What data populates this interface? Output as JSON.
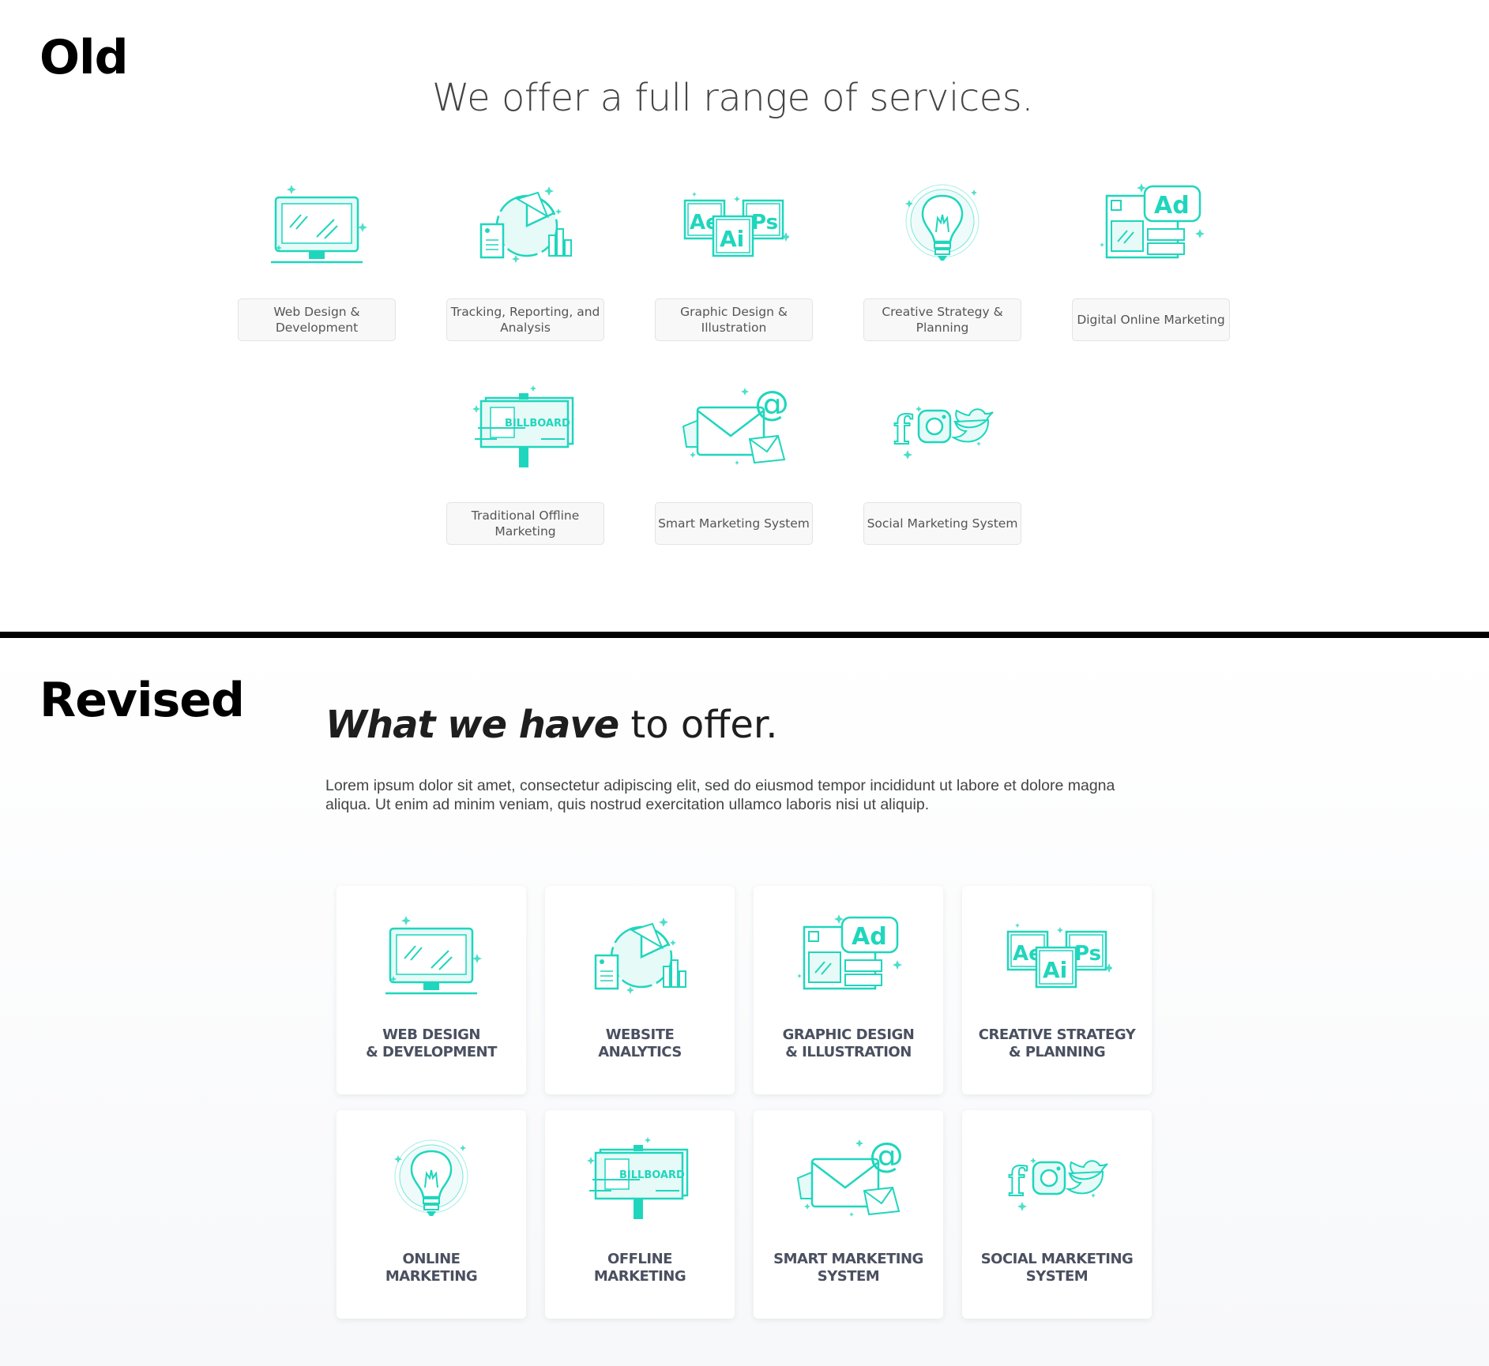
{
  "old": {
    "label": "Old",
    "heading": "We offer a full range of services.",
    "services": [
      {
        "icon": "monitor-code-icon",
        "label": "Web Design & Development"
      },
      {
        "icon": "pie-chart-report-icon",
        "label": "Tracking, Reporting, and Analysis"
      },
      {
        "icon": "adobe-apps-icon",
        "label": "Graphic Design & Illustration"
      },
      {
        "icon": "lightbulb-icon",
        "label": "Creative Strategy & Planning"
      },
      {
        "icon": "ad-browser-icon",
        "label": "Digital Online Marketing"
      },
      {
        "icon": "billboard-icon",
        "label": "Traditional Offline Marketing"
      },
      {
        "icon": "envelope-at-icon",
        "label": "Smart Marketing System"
      },
      {
        "icon": "social-icons-icon",
        "label": "Social Marketing System"
      }
    ]
  },
  "revised": {
    "label": "Revised",
    "heading_strong": "What we have",
    "heading_light": " to offer.",
    "lede": "Lorem ipsum dolor sit amet, consectetur adipiscing elit, sed do eiusmod tempor incididunt ut labore et dolore magna aliqua. Ut enim ad minim veniam, quis nostrud exercitation ullamco laboris nisi ut aliquip.",
    "cards": [
      {
        "icon": "monitor-code-icon",
        "label": "WEB DESIGN\n& DEVELOPMENT"
      },
      {
        "icon": "pie-chart-report-icon",
        "label": "WEBSITE\nANALYTICS"
      },
      {
        "icon": "ad-browser-icon",
        "label": "GRAPHIC DESIGN\n& ILLUSTRATION"
      },
      {
        "icon": "adobe-apps-icon",
        "label": "CREATIVE STRATEGY\n& PLANNING"
      },
      {
        "icon": "lightbulb-icon",
        "label": "ONLINE\nMARKETING"
      },
      {
        "icon": "billboard-icon",
        "label": "OFFLINE\nMARKETING"
      },
      {
        "icon": "envelope-at-icon",
        "label": "SMART MARKETING\nSYSTEM"
      },
      {
        "icon": "social-icons-icon",
        "label": "SOCIAL MARKETING\nSYSTEM"
      }
    ]
  },
  "icon_text": {
    "code": "</>",
    "ae": "Ae",
    "ai": "Ai",
    "ps": "Ps",
    "ad": "Ad",
    "billboard": "BILLBOARD",
    "at": "@",
    "facebook": "f"
  },
  "colors": {
    "accent": "#1fd6bd",
    "accent_light": "#e6faf7",
    "text_dark": "#1e1e1e",
    "label": "#4a5060"
  }
}
